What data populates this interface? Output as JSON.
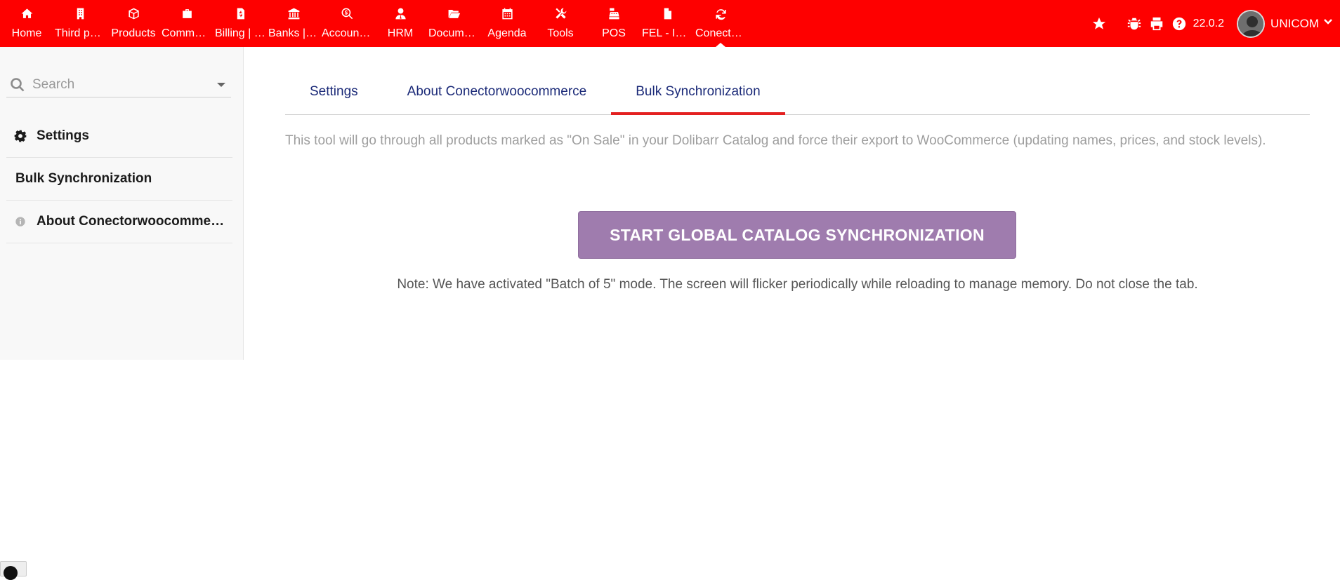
{
  "topbar": {
    "background": "#fe0000",
    "menu": [
      {
        "label": "Home",
        "icon": "home-icon"
      },
      {
        "label": "Third parties",
        "icon": "building-icon"
      },
      {
        "label": "Products",
        "icon": "cube-icon"
      },
      {
        "label": "Commerce",
        "icon": "briefcase-icon"
      },
      {
        "label": "Billing | Payment",
        "icon": "invoice-icon"
      },
      {
        "label": "Banks | Cash",
        "icon": "bank-icon"
      },
      {
        "label": "Accounting",
        "icon": "search-dollar-icon"
      },
      {
        "label": "HRM",
        "icon": "user-tie-icon"
      },
      {
        "label": "Documents",
        "icon": "folder-open-icon"
      },
      {
        "label": "Agenda",
        "icon": "calendar-icon"
      },
      {
        "label": "Tools",
        "icon": "tools-icon"
      },
      {
        "label": "POS",
        "icon": "cash-register-icon"
      },
      {
        "label": "FEL - Invoice",
        "icon": "file-icon"
      },
      {
        "label": "Conectorwoocommerce",
        "icon": "sync-icon",
        "active": true
      }
    ],
    "version": "22.0.2",
    "username": "UNICOM"
  },
  "sidebar": {
    "search_placeholder": "Search",
    "items": [
      {
        "label": "Settings",
        "icon": "gear-icon"
      },
      {
        "label": "Bulk Synchronization",
        "icon": ""
      },
      {
        "label": "About Conectorwoocommerce",
        "icon": "info-icon"
      }
    ]
  },
  "main": {
    "tabs": [
      {
        "label": "Settings"
      },
      {
        "label": "About Conectorwoocommerce"
      },
      {
        "label": "Bulk Synchronization",
        "active": true
      }
    ],
    "description": "This tool will go through all products marked as \"On Sale\" in your Dolibarr Catalog and force their export to WooCommerce (updating names, prices, and stock levels).",
    "button_label": "START GLOBAL CATALOG SYNCHRONIZATION",
    "button_color": "#9f7cae",
    "note": "Note: We have activated \"Batch of 5\" mode. The screen will flicker periodically while reloading to manage memory. Do not close the tab."
  }
}
